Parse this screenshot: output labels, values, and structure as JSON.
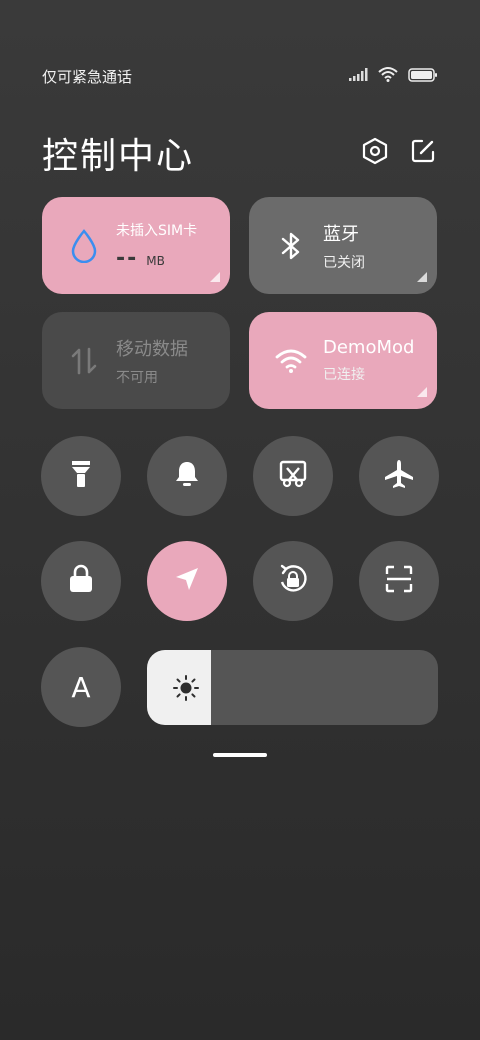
{
  "status_bar": {
    "carrier_text": "仅可紧急通话",
    "icons": [
      "signal-icon",
      "wifi-icon",
      "battery-icon"
    ]
  },
  "header": {
    "title": "控制中心",
    "icons": [
      "settings-icon",
      "edit-icon"
    ]
  },
  "tiles": {
    "data_usage": {
      "label": "未插入SIM卡",
      "value": "--",
      "unit": "MB",
      "icon": "water-drop-icon",
      "active": true
    },
    "bluetooth": {
      "label": "蓝牙",
      "status": "已关闭",
      "icon": "bluetooth-icon",
      "active": false
    },
    "mobile_data": {
      "label": "移动数据",
      "status": "不可用",
      "icon": "data-arrows-icon",
      "active": false
    },
    "wifi": {
      "label": "DemoMod",
      "status": "已连接",
      "icon": "wifi-icon",
      "active": true
    }
  },
  "toggles": [
    {
      "name": "flashlight",
      "icon": "flashlight-icon",
      "active": false
    },
    {
      "name": "notifications",
      "icon": "bell-icon",
      "active": false
    },
    {
      "name": "screenshot",
      "icon": "scissors-icon",
      "active": false
    },
    {
      "name": "airplane-mode",
      "icon": "airplane-icon",
      "active": false
    },
    {
      "name": "lock-screen",
      "icon": "lock-icon",
      "active": false
    },
    {
      "name": "location",
      "icon": "location-arrow-icon",
      "active": true
    },
    {
      "name": "rotation-lock",
      "icon": "rotation-lock-icon",
      "active": false
    },
    {
      "name": "scanner",
      "icon": "scan-icon",
      "active": false
    }
  ],
  "auto_brightness": {
    "label": "A",
    "icon": "auto-brightness-icon"
  },
  "brightness": {
    "level": 0.22,
    "icon": "sun-icon"
  },
  "colors": {
    "accent_pink": "#e9a8bb",
    "toggle_off": "#555555",
    "blue_icon": "#3b8ef0"
  }
}
